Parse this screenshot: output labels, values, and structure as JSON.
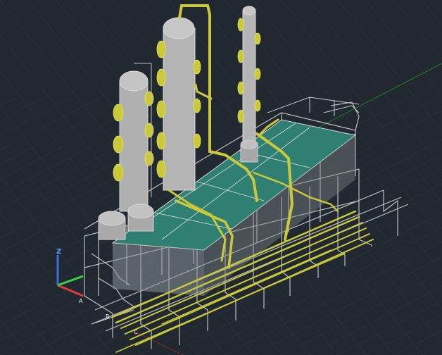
{
  "viewport": {
    "background": "#212830",
    "grid_color": "#2c343e",
    "structure_color": "#c8c8c8",
    "pipe_color": "#c9c93a",
    "deck_color": "#2f7f73",
    "vessel_color": "#b8b8b8"
  },
  "ucs": {
    "z_label": "Z",
    "x_color": "#e03b3b",
    "y_color": "#3bd14a",
    "z_color": "#3b6fe0",
    "origin_icon": "ucs-icon"
  },
  "grid_labels": {
    "a": "A",
    "b": "B",
    "c": "C"
  },
  "model": {
    "description_icon": "3d-process-plant-icon"
  }
}
